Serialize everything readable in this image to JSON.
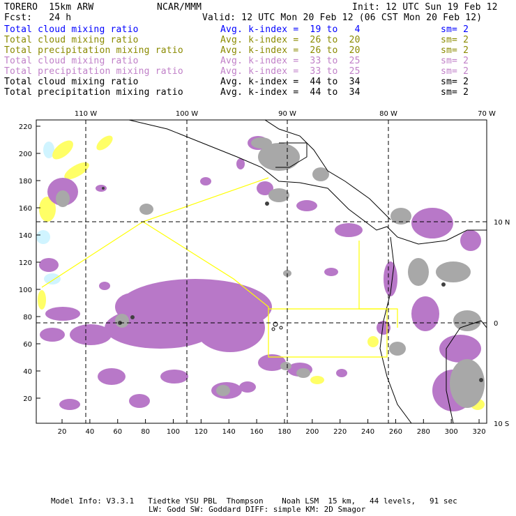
{
  "header": {
    "model": "TORERO  15km ARW",
    "org": "NCAR/MMM",
    "init": "Init: 12 UTC Sun 19 Feb 12",
    "fcst": "Fcst:   24 h",
    "valid": "Valid: 12 UTC Mon 20 Feb 12 (06 CST Mon 20 Feb 12)"
  },
  "legend": [
    {
      "field": "Total cloud mixing ratio",
      "range": "Avg. k-index =  19 to   4",
      "sm": "sm= 2",
      "color": "#0000ff"
    },
    {
      "field": "Total cloud mixing ratio",
      "range": "Avg. k-index =  26 to  20",
      "sm": "sm= 2",
      "color": "#8a8a00"
    },
    {
      "field": "Total precipitation mixing ratio",
      "range": "Avg. k-index =  26 to  20",
      "sm": "sm= 2",
      "color": "#8a8a00"
    },
    {
      "field": "Total cloud mixing ratio",
      "range": "Avg. k-index =  33 to  25",
      "sm": "sm= 2",
      "color": "#c080c8"
    },
    {
      "field": "Total precipitation mixing ratio",
      "range": "Avg. k-index =  33 to  25",
      "sm": "sm= 2",
      "color": "#c080c8"
    },
    {
      "field": "Total cloud mixing ratio",
      "range": "Avg. k-index =  44 to  34",
      "sm": "sm= 2",
      "color": "#000000"
    },
    {
      "field": "Total precipitation mixing ratio",
      "range": "Avg. k-index =  44 to  34",
      "sm": "sm= 2",
      "color": "#000000"
    }
  ],
  "map": {
    "x_ticks": [
      "20",
      "40",
      "60",
      "80",
      "100",
      "120",
      "140",
      "160",
      "180",
      "200",
      "220",
      "240",
      "260",
      "280",
      "300",
      "320"
    ],
    "y_ticks": [
      "220",
      "200",
      "180",
      "160",
      "140",
      "120",
      "100",
      "80",
      "60",
      "40",
      "20"
    ],
    "lon_labels": [
      "110 W",
      "100 W",
      "90 W",
      "80 W",
      "70 W"
    ],
    "lat_labels": [
      "10 N",
      "0",
      "10 S"
    ],
    "colors": {
      "purple": "#b878c8",
      "grey": "#a8a8a8",
      "yellow": "#ffff66",
      "cyan": "#d0f4ff",
      "box": "#ffff00"
    }
  },
  "footer": {
    "line1": "Model Info: V3.3.1   Tiedtke YSU PBL  Thompson    Noah LSM  15 km,   44 levels,   91 sec",
    "line2": "LW: Godd SW: Goddard DIFF: simple KM: 2D Smagor"
  }
}
